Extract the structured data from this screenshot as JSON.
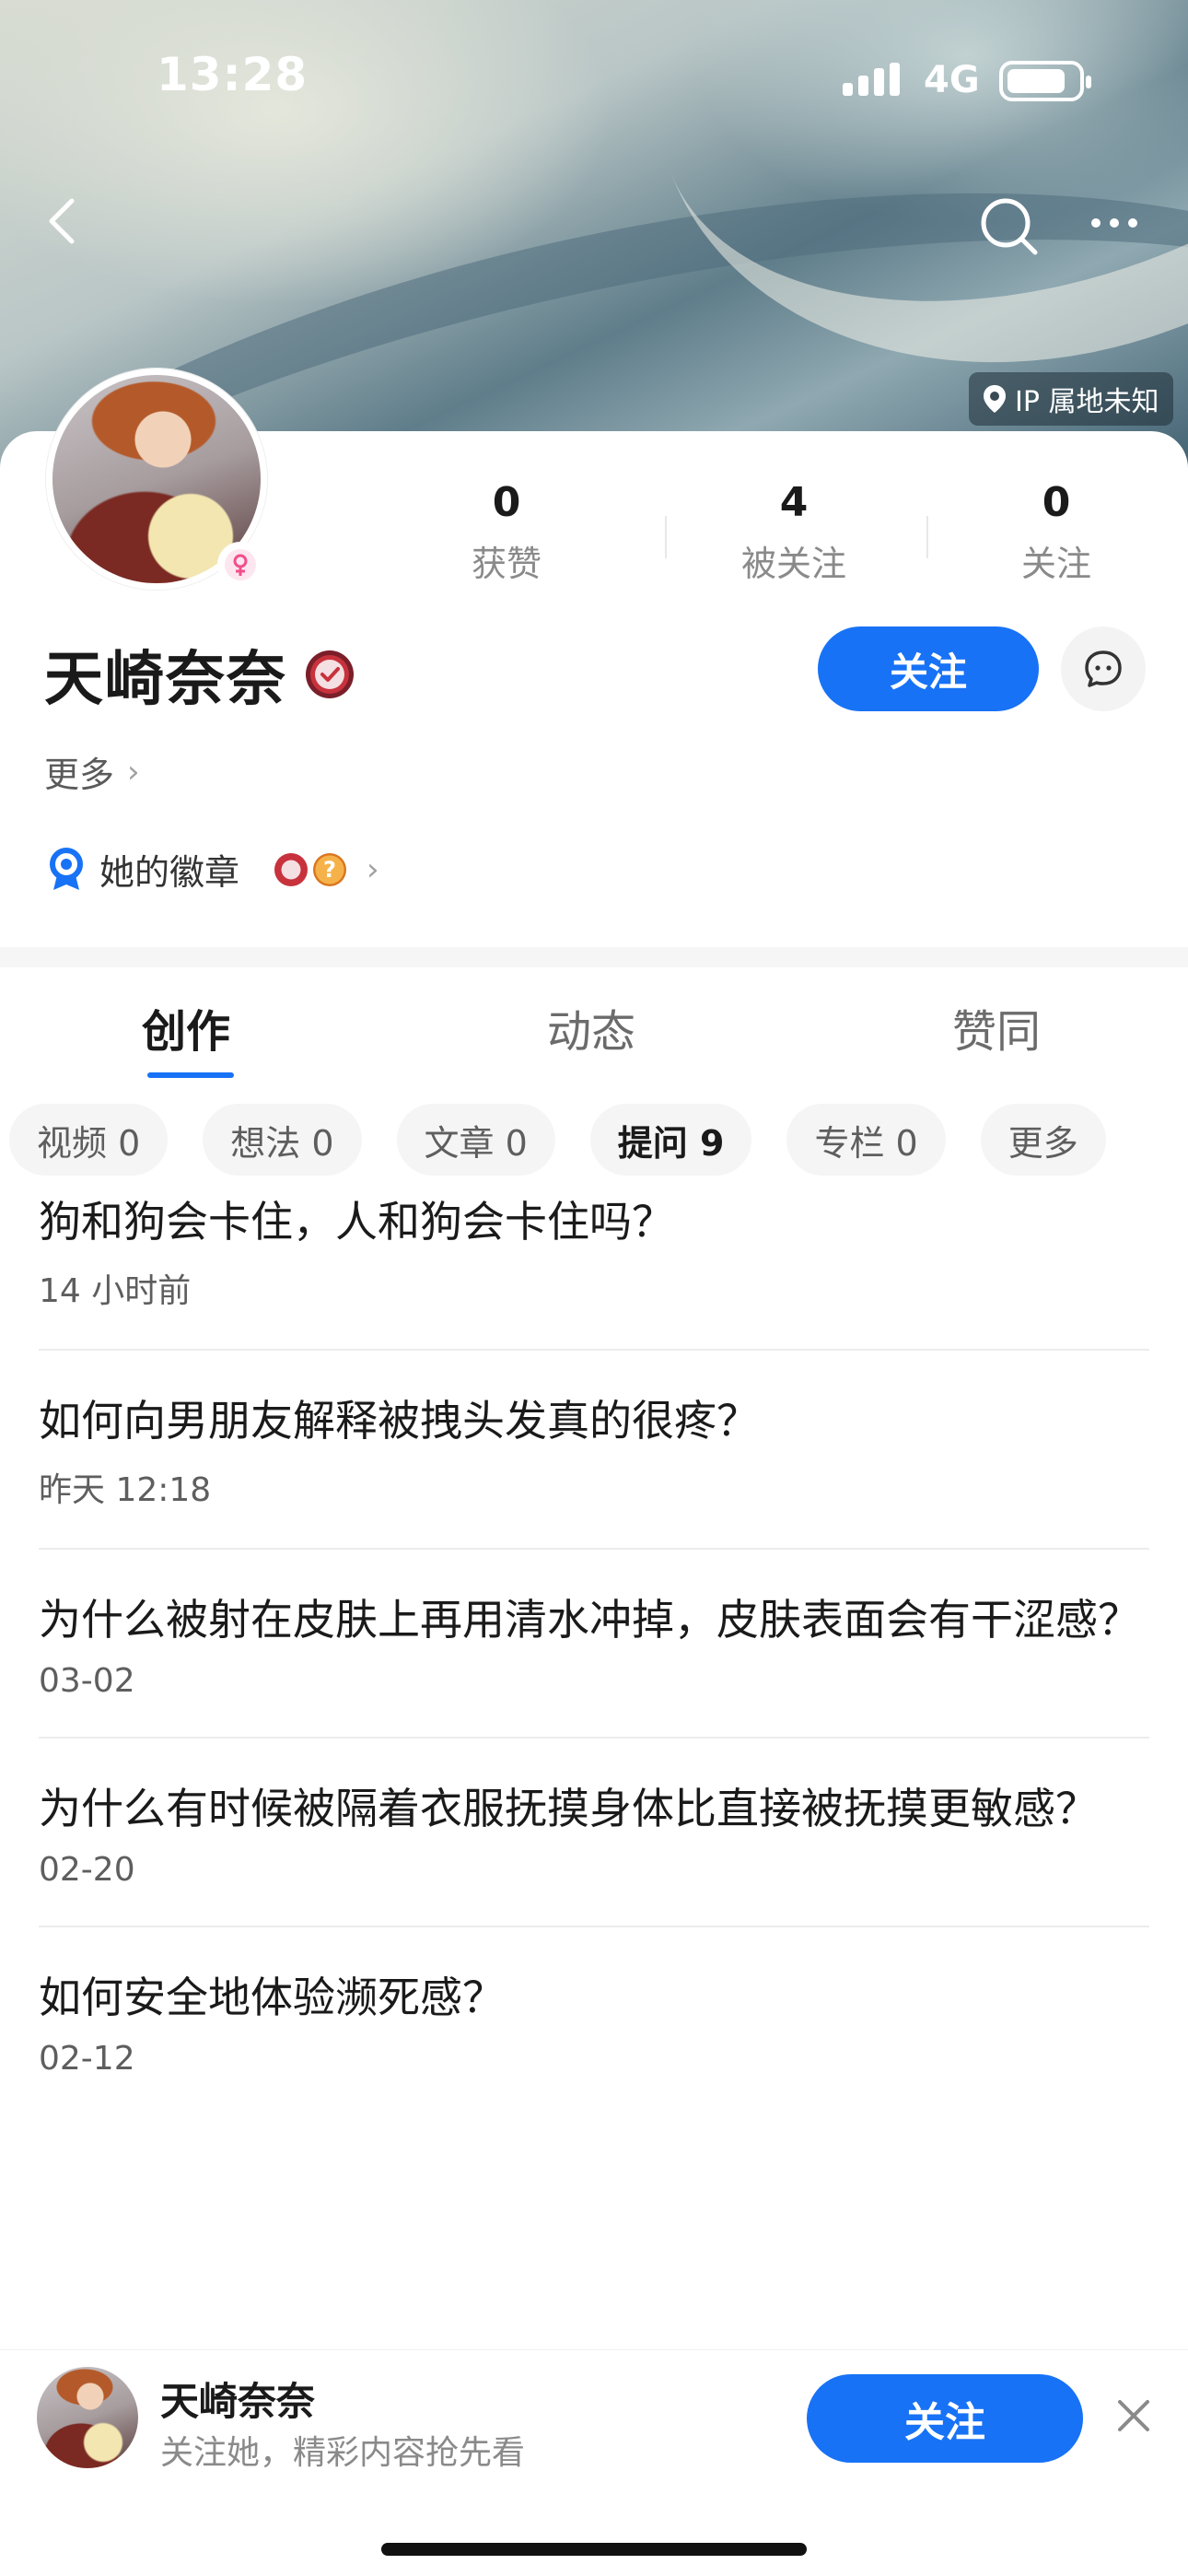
{
  "status_bar": {
    "time": "13:28",
    "network": "4G"
  },
  "header": {
    "ip_location": "IP 属地未知"
  },
  "profile": {
    "name": "天崎奈奈",
    "stats": [
      {
        "value": "0",
        "label": "获赞"
      },
      {
        "value": "4",
        "label": "被关注"
      },
      {
        "value": "0",
        "label": "关注"
      }
    ],
    "follow_label": "关注",
    "more_label": "更多",
    "badges_label": "她的徽章"
  },
  "tabs": [
    {
      "label": "创作",
      "active": true
    },
    {
      "label": "动态",
      "active": false
    },
    {
      "label": "赞同",
      "active": false
    }
  ],
  "chips": [
    {
      "label": "视频 0"
    },
    {
      "label": "想法 0"
    },
    {
      "label": "文章 0"
    },
    {
      "label": "提问 9",
      "active": true
    },
    {
      "label": "专栏 0"
    },
    {
      "label": "更多"
    }
  ],
  "questions": [
    {
      "title": "狗和狗会卡住，人和狗会卡住吗？",
      "time": "14 小时前"
    },
    {
      "title": "如何向男朋友解释被拽头发真的很疼？",
      "time": "昨天 12:18"
    },
    {
      "title": "为什么被射在皮肤上再用清水冲掉，皮肤表面会有干涩感？",
      "time": "03-02"
    },
    {
      "title": "为什么有时候被隔着衣服抚摸身体比直接被抚摸更敏感？",
      "time": "02-20"
    },
    {
      "title": "如何安全地体验濒死感？",
      "time": "02-12"
    }
  ],
  "bottom_bar": {
    "name": "天崎奈奈",
    "subtitle": "关注她，精彩内容抢先看",
    "follow_label": "关注"
  },
  "colors": {
    "accent": "#1772f6",
    "verify": "#c8323c",
    "gender": "#f0508c"
  }
}
